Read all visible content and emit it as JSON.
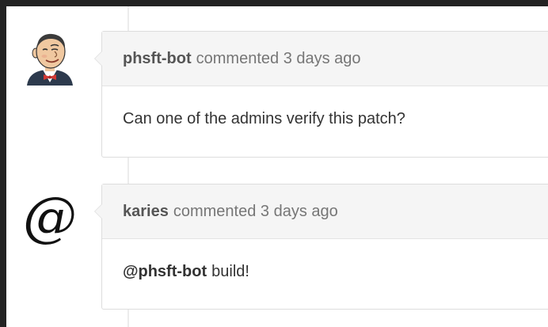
{
  "comments": [
    {
      "author": "phsft-bot",
      "meta": "commented 3 days ago",
      "body": "Can one of the admins verify this patch?",
      "avatar": "jenkins-butler-avatar"
    },
    {
      "author": "karies",
      "meta": "commented 3 days ago",
      "mention": "@phsft-bot",
      "body": "build!",
      "avatar_glyph": "@"
    }
  ],
  "colors": {
    "header_bg": "#f5f5f5",
    "border": "#dddddd",
    "author_text": "#555555",
    "meta_text": "#767676",
    "body_text": "#333333"
  }
}
